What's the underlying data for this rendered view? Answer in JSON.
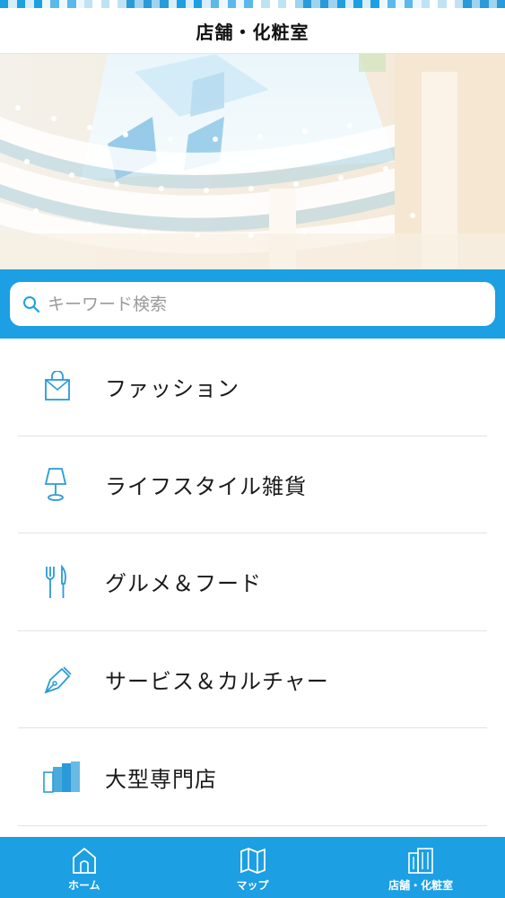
{
  "header": {
    "title": "店舗・化粧室"
  },
  "search": {
    "placeholder": "キーワード検索",
    "icon": "search-icon"
  },
  "categories": [
    {
      "label": "ファッション",
      "icon": "shopping-bag-icon"
    },
    {
      "label": "ライフスタイル雑貨",
      "icon": "lamp-icon"
    },
    {
      "label": "グルメ＆フード",
      "icon": "fork-knife-icon"
    },
    {
      "label": "サービス＆カルチャー",
      "icon": "pen-nib-icon"
    },
    {
      "label": "大型専門店",
      "icon": "building-icon"
    }
  ],
  "tabbar": {
    "tabs": [
      {
        "label": "ホーム",
        "icon": "home-icon"
      },
      {
        "label": "マップ",
        "icon": "map-icon"
      },
      {
        "label": "店舗・化粧室",
        "icon": "store-building-icon"
      }
    ]
  },
  "colors": {
    "accent": "#1c9fe3",
    "icon": "#2a9bd8"
  }
}
